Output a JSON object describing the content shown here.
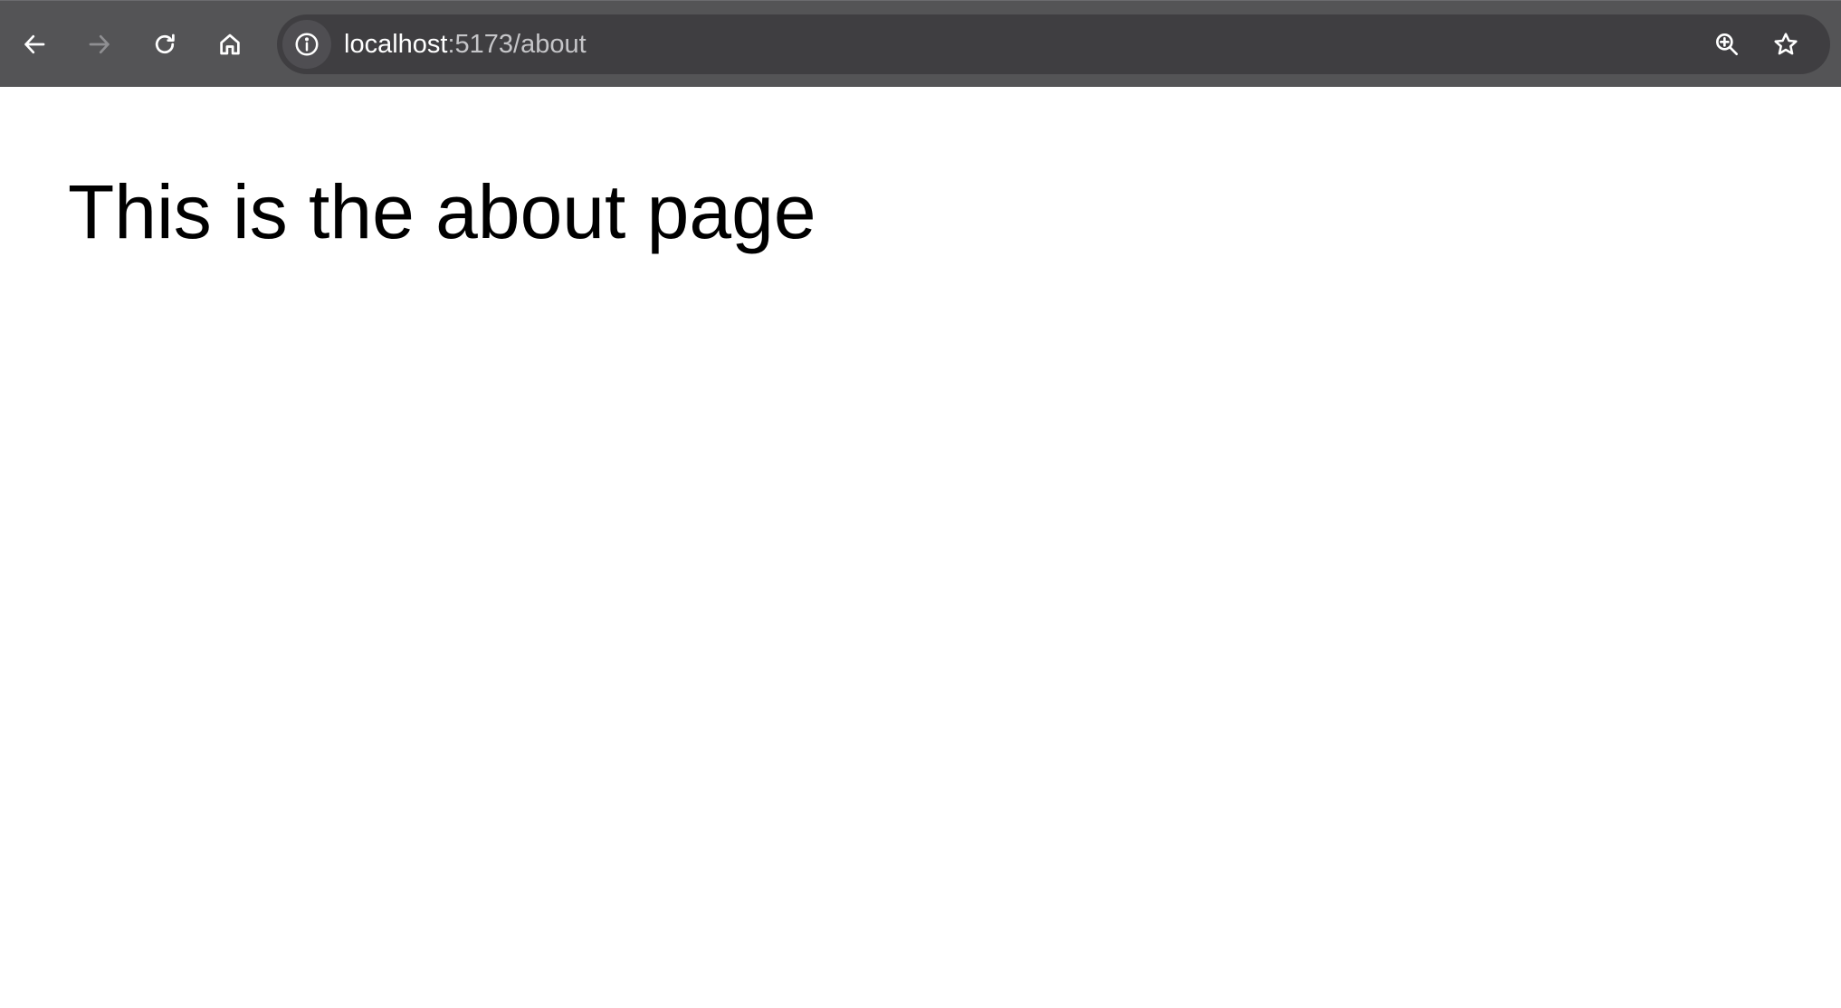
{
  "browser": {
    "url_host": "localhost",
    "url_path": ":5173/about",
    "icons": {
      "back": "arrow-left-icon",
      "forward": "arrow-right-icon",
      "reload": "reload-icon",
      "home": "home-icon",
      "site_info": "info-icon",
      "zoom": "zoom-in-icon",
      "bookmark": "star-icon"
    },
    "colors": {
      "toolbar": "#545456",
      "omnibox": "#3f3e41"
    }
  },
  "page": {
    "heading": "This is the about page"
  }
}
